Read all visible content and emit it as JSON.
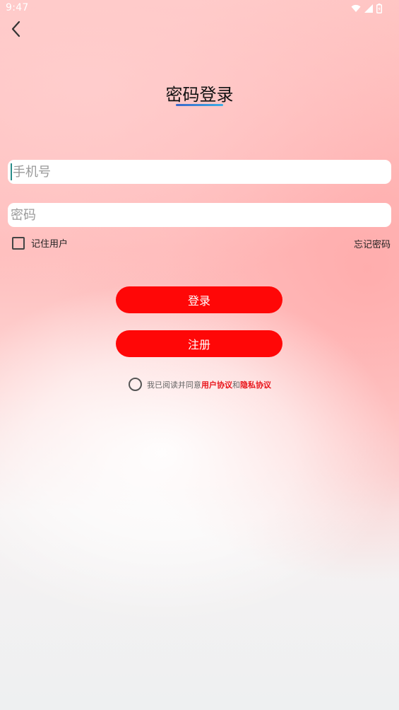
{
  "status_bar": {
    "time": "9:47",
    "icons": [
      "wifi-icon",
      "cell-signal-icon",
      "battery-icon"
    ]
  },
  "header": {
    "back_icon": "chevron-left-icon",
    "title": "密码登录"
  },
  "form": {
    "phone_placeholder": "手机号",
    "password_placeholder": "密码",
    "remember_label": "记住用户",
    "forgot_label": "忘记密码"
  },
  "buttons": {
    "login_label": "登录",
    "register_label": "注册"
  },
  "agreement": {
    "prefix": "我已阅读并同意",
    "user_agreement": "用户协议",
    "conjunction": "和",
    "privacy_policy": "隐私协议"
  },
  "colors": {
    "accent": "#ff0707",
    "link": "#e8141a",
    "title_underline": "#3a8fd8"
  }
}
